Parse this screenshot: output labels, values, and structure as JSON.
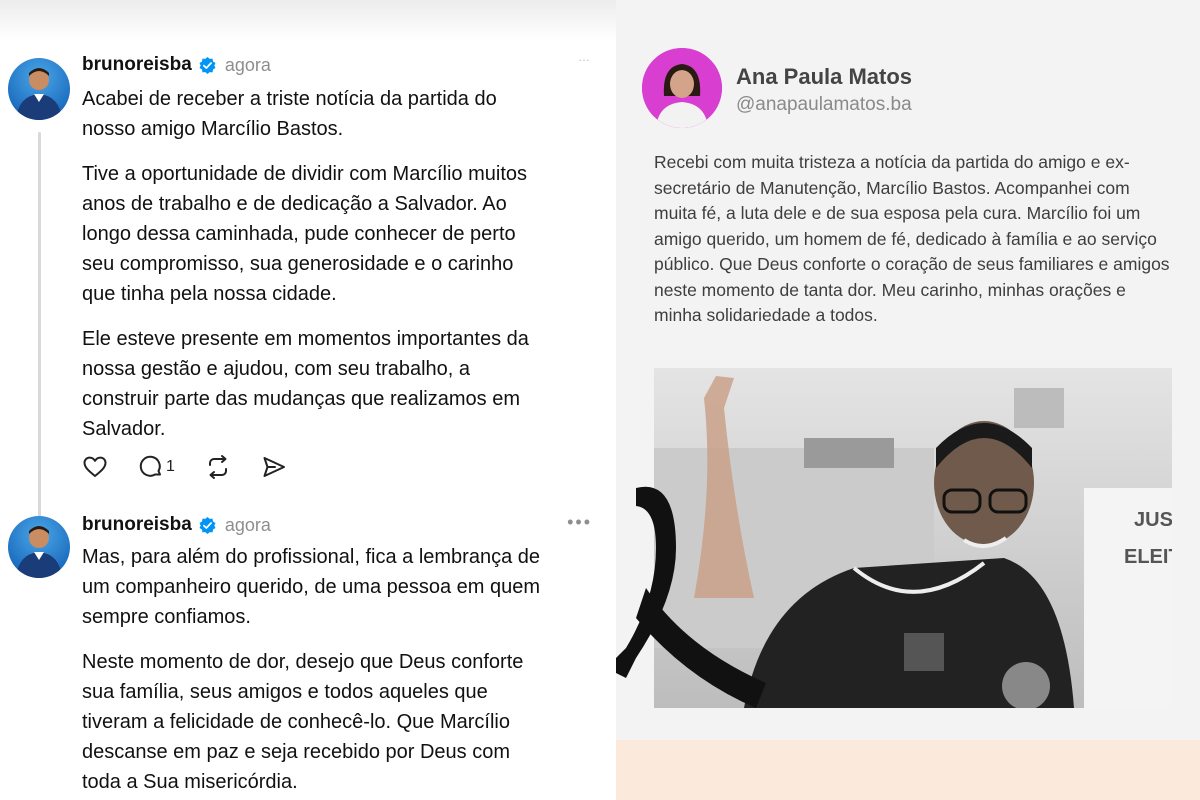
{
  "left_panel": {
    "post1": {
      "username": "brunoreisba",
      "time": "agora",
      "more": "…",
      "paragraphs": [
        "Acabei de receber a triste notícia da partida do\nnosso amigo Marcílio Bastos.",
        "Tive a oportunidade de dividir com Marcílio muitos\nanos de trabalho e de dedicação a Salvador. Ao\nlongo dessa caminhada, pude conhecer de perto\nseu compromisso, sua generosidade e o carinho\nque tinha pela nossa cidade.",
        "Ele esteve presente em momentos importantes da\nnossa gestão e ajudou, com seu trabalho, a\nconstruir parte das mudanças que realizamos em\nSalvador."
      ],
      "actions": {
        "like_icon": "heart-icon",
        "reply_icon": "comment-icon",
        "reply_count": "1",
        "repost_icon": "repost-icon",
        "share_icon": "send-icon"
      }
    },
    "post2": {
      "username": "brunoreisba",
      "time": "agora",
      "more": "•••",
      "paragraphs": [
        "Mas, para além do profissional, fica a lembrança de\num companheiro querido, de uma pessoa em quem\nsempre confiamos.",
        "Neste momento de dor, desejo que Deus conforte\nsua família, seus amigos e todos aqueles que\ntiveram a felicidade de conhecê-lo. Que Marcílio\ndescanse em paz e seja recebido por Deus com\ntoda a Sua misericórdia."
      ]
    },
    "verified_color": "#0095f6"
  },
  "right_panel": {
    "name": "Ana Paula Matos",
    "handle": "@anapaulamatos.ba",
    "text": "Recebi com muita tristeza a notícia da partida do amigo e ex-secretário de Manutenção, Marcílio Bastos. Acompanhei  com muita fé, a luta dele e de sua esposa pela cura. Marcílio foi um amigo querido, um homem de fé, dedicado à família e ao serviço público. Que Deus conforte o coração de seus familiares e amigos neste momento de tanta dor. Meu carinho, minhas orações e minha solidariedade a todos.",
    "photo_sign_lines": [
      "JUST",
      "ELEIT"
    ],
    "avatar_bg_color": "#d83fd1",
    "ribbon_icon": "mourning-ribbon-icon"
  }
}
